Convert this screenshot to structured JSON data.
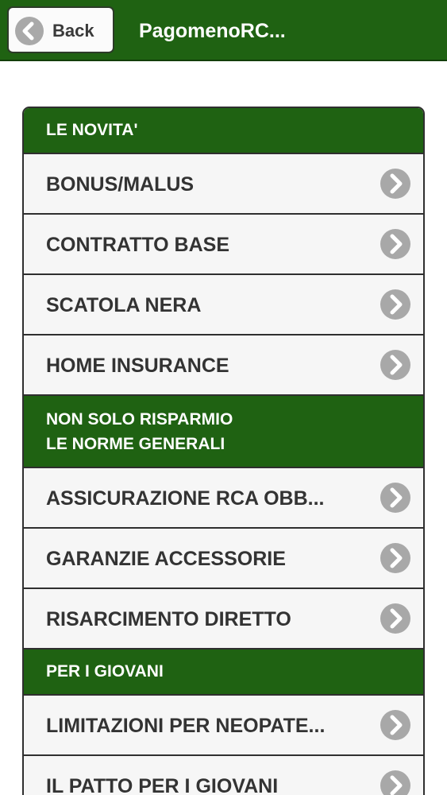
{
  "navbar": {
    "back_label": "Back",
    "title": "PagomenoRC..."
  },
  "sections": [
    {
      "header_lines": [
        "LE NOVITA'"
      ],
      "items": [
        "BONUS/MALUS",
        "CONTRATTO BASE",
        "SCATOLA NERA",
        "HOME INSURANCE"
      ]
    },
    {
      "header_lines": [
        "NON SOLO RISPARMIO",
        "LE NORME GENERALI"
      ],
      "items": [
        "ASSICURAZIONE RCA OBB...",
        "GARANZIE ACCESSORIE",
        "RISARCIMENTO DIRETTO"
      ]
    },
    {
      "header_lines": [
        "PER I GIOVANI"
      ],
      "items": [
        "LIMITAZIONI PER NEOPATE...",
        "IL PATTO PER I GIOVANI"
      ]
    }
  ],
  "icons": {
    "back": "chevron-left-icon",
    "row": "chevron-right-icon"
  },
  "colors": {
    "header_green": "#1f6212",
    "row_background": "#f6f6f6",
    "chevron_gray": "#a8a8a8"
  }
}
